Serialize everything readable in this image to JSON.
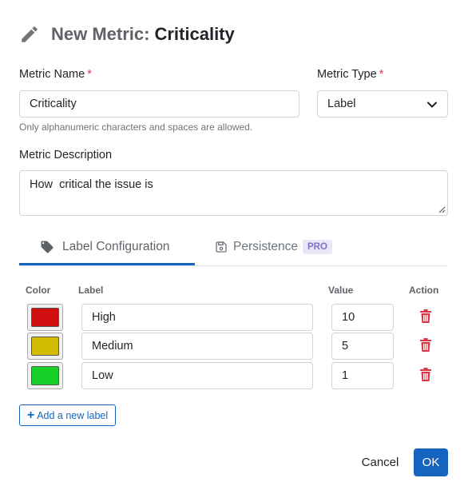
{
  "title": {
    "prefix": "New Metric:",
    "name": "Criticality"
  },
  "metric_name": {
    "label": "Metric Name",
    "required_mark": "*",
    "value": "Criticality",
    "help": "Only alphanumeric characters and spaces are allowed."
  },
  "metric_type": {
    "label": "Metric Type",
    "required_mark": "*",
    "value": "Label"
  },
  "metric_description": {
    "label": "Metric Description",
    "value": "How  critical the issue is"
  },
  "tabs": [
    {
      "label": "Label Configuration",
      "active": true
    },
    {
      "label": "Persistence",
      "badge": "PRO",
      "active": false
    }
  ],
  "table": {
    "headers": {
      "color": "Color",
      "label": "Label",
      "value": "Value",
      "action": "Action"
    },
    "rows": [
      {
        "color": "#d01010",
        "label": "High",
        "value": "10"
      },
      {
        "color": "#d4bc05",
        "label": "Medium",
        "value": "5"
      },
      {
        "color": "#18d028",
        "label": "Low",
        "value": "1"
      }
    ]
  },
  "add_label_button": "Add a new label",
  "footer": {
    "cancel": "Cancel",
    "ok": "OK"
  },
  "colors": {
    "accent": "#1565c0",
    "danger": "#dc3545"
  },
  "icons": {
    "title": "pencil-icon",
    "tab_label": "tag-icon",
    "tab_persistence": "save-icon",
    "delete": "trash-icon",
    "dropdown": "chevron-down-icon"
  }
}
